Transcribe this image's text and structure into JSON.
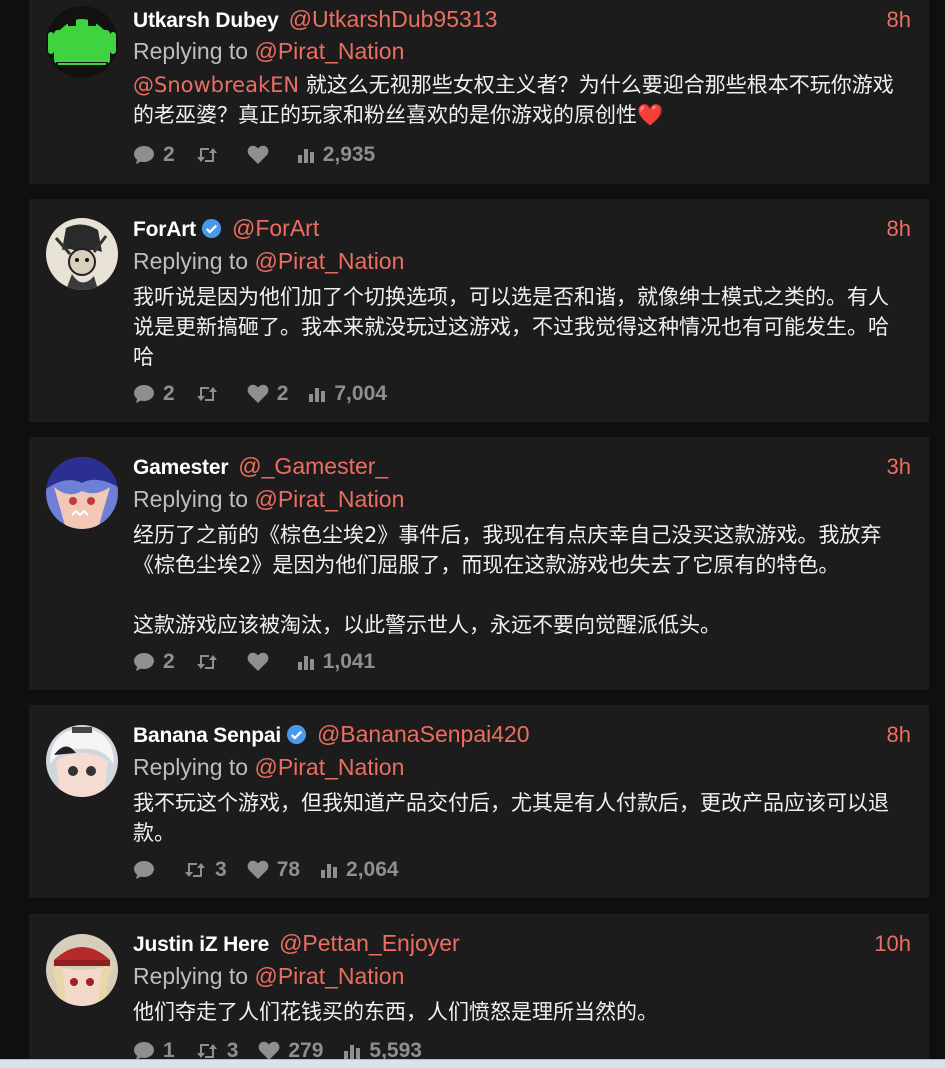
{
  "colors": {
    "background": "#0f0f0f",
    "card": "#1c1c1c",
    "accent": "#ec6e61",
    "muted": "#8f8f8f",
    "verified": "#4a98e9"
  },
  "tweets": [
    {
      "name": "Utkarsh Dubey",
      "handle": "@UtkarshDub95313",
      "verified": false,
      "time": "8h",
      "replying_prefix": "Replying to",
      "replying_to": "@Pirat_Nation",
      "mention": "@SnowbreakEN",
      "text": " 就这么无视那些女权主义者？为什么要迎合那些根本不玩你游戏的老巫婆？真正的玩家和粉丝喜欢的是你游戏的原创性",
      "emoji": "❤️",
      "avatar_icon": "android-robot-icon",
      "stats": {
        "replies": "2",
        "retweets": "",
        "likes": "",
        "views": "2,935"
      }
    },
    {
      "name": "ForArt",
      "handle": "@ForArt",
      "verified": true,
      "time": "8h",
      "replying_prefix": "Replying to",
      "replying_to": "@Pirat_Nation",
      "text": "我听说是因为他们加了个切换选项，可以选是否和谐，就像绅士模式之类的。有人说是更新搞砸了。我本来就没玩过这游戏，不过我觉得这种情况也有可能发生。哈哈",
      "avatar_icon": "sketch-art-avatar-icon",
      "stats": {
        "replies": "2",
        "retweets": "",
        "likes": "2",
        "views": "7,004"
      }
    },
    {
      "name": "Gamester",
      "handle": "@_Gamester_",
      "verified": false,
      "time": "3h",
      "replying_prefix": "Replying to",
      "replying_to": "@Pirat_Nation",
      "text": "经历了之前的《棕色尘埃2》事件后，我现在有点庆幸自己没买这款游戏。我放弃《棕色尘埃2》是因为他们屈服了，而现在这款游戏也失去了它原有的特色。\n\n这款游戏应该被淘汰，以此警示世人，永远不要向觉醒派低头。",
      "avatar_icon": "anime-character-avatar-icon",
      "stats": {
        "replies": "2",
        "retweets": "",
        "likes": "",
        "views": "1,041"
      }
    },
    {
      "name": "Banana Senpai",
      "handle": "@BananaSenpai420",
      "verified": true,
      "time": "8h",
      "replying_prefix": "Replying to",
      "replying_to": "@Pirat_Nation",
      "text": "我不玩这个游戏，但我知道产品交付后，尤其是有人付款后，更改产品应该可以退款。",
      "avatar_icon": "anime-character-avatar-icon",
      "stats": {
        "replies": "",
        "retweets": "3",
        "likes": "78",
        "views": "2,064"
      }
    },
    {
      "name": "Justin iZ Here",
      "handle": "@Pettan_Enjoyer",
      "verified": false,
      "time": "10h",
      "replying_prefix": "Replying to",
      "replying_to": "@Pirat_Nation",
      "text": "他们夺走了人们花钱买的东西，人们愤怒是理所当然的。",
      "avatar_icon": "anime-character-red-cap-avatar-icon",
      "stats": {
        "replies": "1",
        "retweets": "3",
        "likes": "279",
        "views": "5,593"
      }
    }
  ]
}
